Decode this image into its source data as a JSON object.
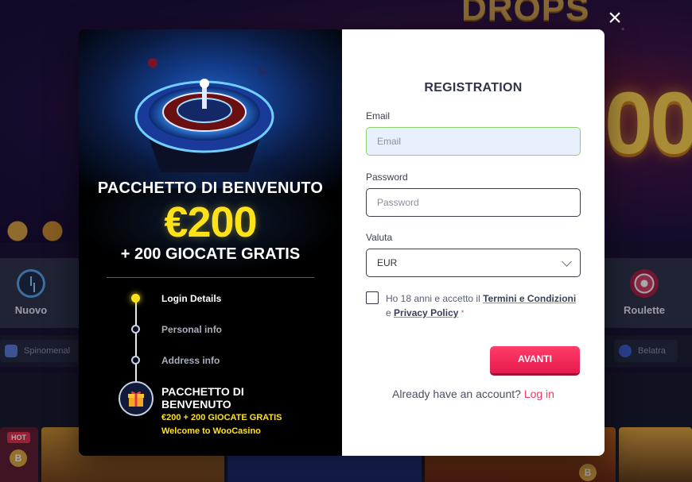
{
  "background": {
    "hero_title": "DROPS",
    "hero_amount": "00",
    "categories": [
      {
        "label": "Nuovo",
        "icon": "clock-icon"
      },
      {
        "label": "Roulette",
        "icon": "roulette-icon"
      }
    ],
    "providers": [
      "Spinomenal",
      "Belatra"
    ],
    "hot_badge": "HOT",
    "coin_symbol": "B"
  },
  "modal": {
    "close_icon": "close-icon",
    "promo": {
      "headline_1": "PACCHETTO DI BENVENUTO",
      "amount": "€200",
      "headline_2": "+ 200 GIOCATE GRATIS",
      "steps": [
        {
          "label": "Login Details",
          "active": true
        },
        {
          "label": "Personal info",
          "active": false
        },
        {
          "label": "Address info",
          "active": false
        }
      ],
      "bonus_icon": "gift-icon",
      "bonus_title": "PACCHETTO DI BENVENUTO",
      "bonus_subtitle": "€200 + 200 GIOCATE GRATIS",
      "bonus_welcome": "Welcome to WooCasino"
    },
    "form": {
      "title": "REGISTRATION",
      "email_label": "Email",
      "email_placeholder": "Email",
      "password_label": "Password",
      "password_placeholder": "Password",
      "currency_label": "Valuta",
      "currency_value": "EUR",
      "terms_prefix": "Ho 18 anni e accetto il",
      "terms_link": "Termini e Condizioni",
      "terms_and": "e",
      "privacy_link": "Privacy Policy",
      "required_mark": "*",
      "submit_label": "AVANTI",
      "login_prompt": "Already have an account?",
      "login_link": "Log in"
    }
  },
  "colors": {
    "accent_yellow": "#ffe11a",
    "cta_red": "#ff3d6a",
    "link_red": "#ef3a62",
    "email_valid_border": "#8bd16c"
  }
}
